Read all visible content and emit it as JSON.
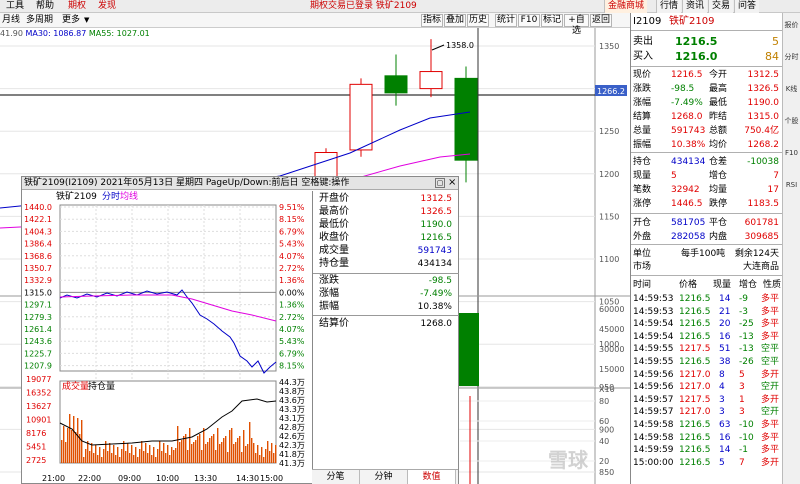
{
  "menubar": {
    "items": [
      "工具",
      "帮助",
      "期权",
      "发现"
    ],
    "notice": "期权交易已登录 铁矿2109",
    "right_tabs": [
      "金融商城",
      "行情",
      "资讯",
      "交易",
      "问答"
    ]
  },
  "subbar": {
    "items": [
      "月线",
      "多周期",
      "更多"
    ],
    "toolbar": [
      "指标",
      "叠加",
      "历史",
      "统计",
      "F10",
      "标记",
      "+自选",
      "返回"
    ]
  },
  "indicator_line": {
    "value_prefix": "41.90",
    "ma30": "MA30: 1086.87",
    "ma55": "MA55: 1027.01"
  },
  "kchart": {
    "price_axis": [
      "1350",
      "1300",
      "1250",
      "1200",
      "1150",
      "1100",
      "1050",
      "1000",
      "950",
      "900",
      "850"
    ],
    "vol_axis": [
      "60000",
      "45000",
      "30000",
      "15000",
      "X10"
    ],
    "lower_axis": [
      "80",
      "60",
      "40",
      "20"
    ],
    "current_price_tag": "1266.2",
    "high_label": "1358.0",
    "colors": {
      "up": "#e00000",
      "down": "#008000",
      "ma1": "#0000c8",
      "ma2": "#e000e0"
    }
  },
  "quote_panel": {
    "code": "I2109",
    "name": "铁矿2109",
    "sell_label": "卖出",
    "sell_price": "1216.5",
    "sell_vol": "5",
    "buy_label": "买入",
    "buy_price": "1216.0",
    "buy_vol": "84",
    "rows": [
      {
        "l1": "现价",
        "v1": "1216.5",
        "l2": "今开",
        "v2": "1312.5"
      },
      {
        "l1": "涨跌",
        "v1": "-98.5",
        "l2": "最高",
        "v2": "1326.5"
      },
      {
        "l1": "涨幅",
        "v1": "-7.49%",
        "l2": "最低",
        "v2": "1190.0"
      },
      {
        "l1": "结算",
        "v1": "1268.0",
        "l2": "昨结",
        "v2": "1315.0"
      },
      {
        "l1": "总量",
        "v1": "591743",
        "l2": "总额",
        "v2": "750.4亿"
      },
      {
        "l1": "振幅",
        "v1": "10.38%",
        "l2": "均价",
        "v2": "1268.2"
      }
    ],
    "rows2": [
      {
        "l1": "持仓",
        "v1": "434134",
        "l2": "仓差",
        "v2": "-10038"
      },
      {
        "l1": "现量",
        "v1": "5",
        "l2": "增仓",
        "v2": "7"
      },
      {
        "l1": "笔数",
        "v1": "32942",
        "l2": "均量",
        "v2": "17"
      },
      {
        "l1": "涨停",
        "v1": "1446.5",
        "l2": "跌停",
        "v2": "1183.5"
      }
    ],
    "rows3": [
      {
        "l1": "开仓",
        "v1": "581705",
        "l2": "平仓",
        "v2": "601781"
      },
      {
        "l1": "外盘",
        "v1": "282058",
        "l2": "内盘",
        "v2": "309685"
      }
    ],
    "unit_label": "单位",
    "unit_value": "每手100吨",
    "days_label": "剩余124天",
    "market_label": "市场",
    "market_value": "大连商品",
    "tick_header": [
      "时间",
      "价格",
      "现量",
      "增仓",
      "性质"
    ],
    "ticks": [
      {
        "t": "14:59:53",
        "p": "1216.5",
        "v": "14",
        "d": "-9",
        "k": "多平"
      },
      {
        "t": "14:59:53",
        "p": "1216.5",
        "v": "21",
        "d": "-3",
        "k": "多平"
      },
      {
        "t": "14:59:54",
        "p": "1216.5",
        "v": "20",
        "d": "-25",
        "k": "多平"
      },
      {
        "t": "14:59:54",
        "p": "1216.5",
        "v": "16",
        "d": "-13",
        "k": "多平"
      },
      {
        "t": "14:59:55",
        "p": "1217.5",
        "v": "51",
        "d": "-13",
        "k": "空平"
      },
      {
        "t": "14:59:55",
        "p": "1216.5",
        "v": "38",
        "d": "-26",
        "k": "空平"
      },
      {
        "t": "14:59:56",
        "p": "1217.0",
        "v": "8",
        "d": "5",
        "k": "多开"
      },
      {
        "t": "14:59:56",
        "p": "1217.0",
        "v": "4",
        "d": "3",
        "k": "空开"
      },
      {
        "t": "14:59:57",
        "p": "1217.5",
        "v": "3",
        "d": "1",
        "k": "多开"
      },
      {
        "t": "14:59:57",
        "p": "1217.0",
        "v": "3",
        "d": "3",
        "k": "空开"
      },
      {
        "t": "14:59:58",
        "p": "1216.5",
        "v": "63",
        "d": "-10",
        "k": "多平"
      },
      {
        "t": "14:59:58",
        "p": "1216.5",
        "v": "16",
        "d": "-10",
        "k": "多平"
      },
      {
        "t": "14:59:59",
        "p": "1216.5",
        "v": "14",
        "d": "-1",
        "k": "多平"
      },
      {
        "t": "15:00:00",
        "p": "1216.5",
        "v": "5",
        "d": "7",
        "k": "多开"
      }
    ]
  },
  "sidebar": [
    "报价",
    "分时",
    "K线",
    "个股",
    "F10",
    "RSI"
  ],
  "popup": {
    "title": "铁矿2109(I2109)  2021年05月13日 星期四 PageUp/Down:前后日 空格键:操作",
    "tab_name": "铁矿2109",
    "tab_fenshi": "分时",
    "tab_avg": "均线",
    "left_axis": [
      "1440.0",
      "1422.1",
      "1404.3",
      "1386.4",
      "1368.6",
      "1350.7",
      "1332.9",
      "1315.0",
      "1297.1",
      "1279.3",
      "1261.4",
      "1243.6",
      "1225.7",
      "1207.9"
    ],
    "right_axis": [
      "9.51%",
      "8.15%",
      "6.79%",
      "5.43%",
      "4.07%",
      "2.72%",
      "1.36%",
      "0.00%",
      "1.36%",
      "2.72%",
      "4.07%",
      "5.43%",
      "6.79%",
      "8.15%"
    ],
    "vol_label": "成交量",
    "oi_label": "持仓量",
    "vol_axis": [
      "19077",
      "16352",
      "13627",
      "10901",
      "8176",
      "5451",
      "2725"
    ],
    "oi_axis": [
      "44.3万",
      "43.8万",
      "43.6万",
      "43.3万",
      "43.1万",
      "42.8万",
      "42.6万",
      "42.3万",
      "41.8万",
      "41.3万"
    ],
    "time_axis": [
      "21:00",
      "22:00",
      "09:00",
      "10:00",
      "13:30",
      "14:30",
      "15:00"
    ],
    "info": [
      {
        "label": "开盘价",
        "value": "1312.5",
        "cls": "red"
      },
      {
        "label": "最高价",
        "value": "1326.5",
        "cls": "red"
      },
      {
        "label": "最低价",
        "value": "1190.0",
        "cls": "grn"
      },
      {
        "label": "收盘价",
        "value": "1216.5",
        "cls": "grn"
      },
      {
        "label": "成交量",
        "value": "591743",
        "cls": "blu"
      },
      {
        "label": "持仓量",
        "value": "434134",
        "cls": ""
      }
    ],
    "info2": [
      {
        "label": "涨跌",
        "value": "-98.5",
        "cls": "grn"
      },
      {
        "label": "涨幅",
        "value": "-7.49%",
        "cls": "grn"
      },
      {
        "label": "振幅",
        "value": "10.38%",
        "cls": ""
      }
    ],
    "settle_label": "结算价",
    "settle_value": "1268.0",
    "bottom_tabs": [
      "分笔",
      "分钟",
      "数值"
    ]
  },
  "watermark": "雪球"
}
